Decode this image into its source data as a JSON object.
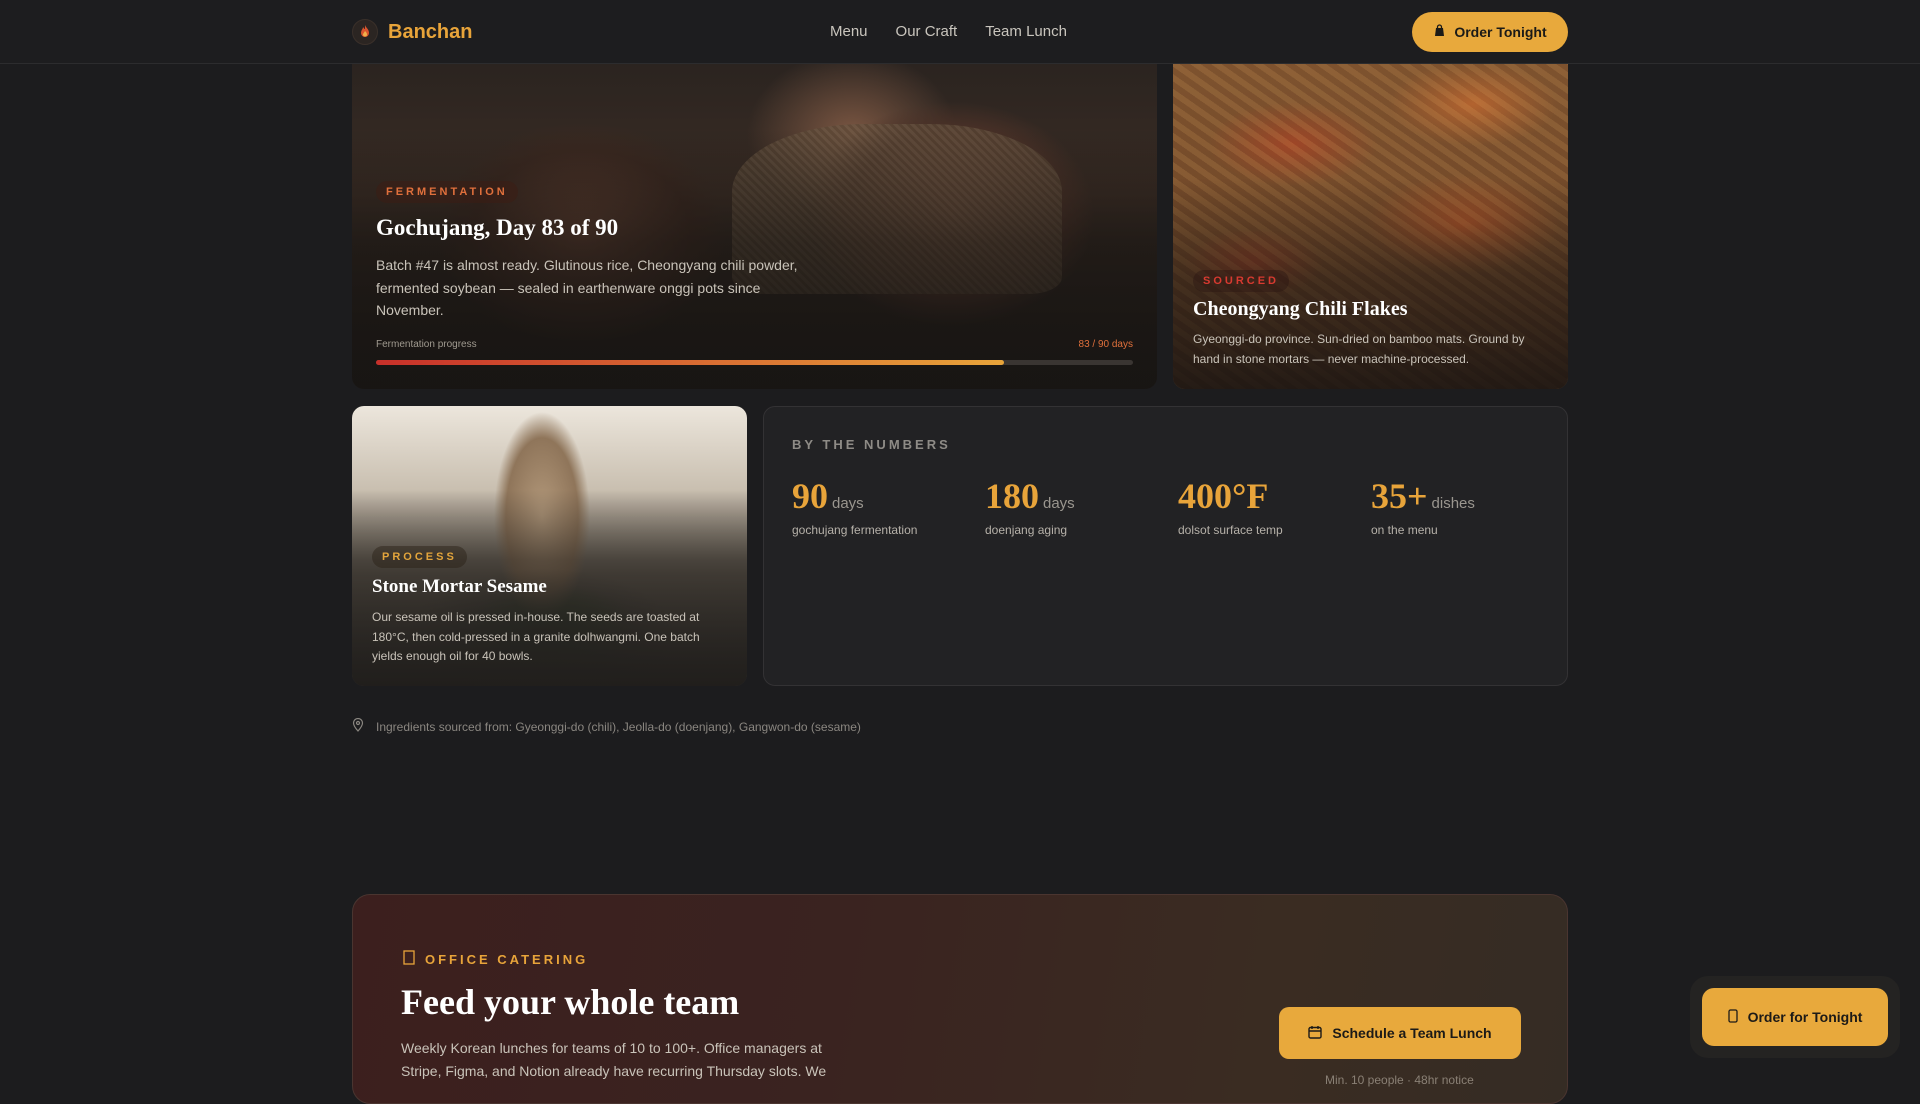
{
  "brand": {
    "name": "Banchan"
  },
  "nav": {
    "links": [
      "Menu",
      "Our Craft",
      "Team Lunch"
    ],
    "cta": "Order Tonight"
  },
  "hero": {
    "tag": "FERMENTATION",
    "title": "Gochujang, Day 83 of 90",
    "description": "Batch #47 is almost ready. Glutinous rice, Cheongyang chili powder, fermented soybean — sealed in earthenware onggi pots since November.",
    "progress_label": "Fermentation progress",
    "progress_count": "83 / 90 days",
    "progress_value": 0.922
  },
  "chili": {
    "tag": "SOURCED",
    "title": "Cheongyang Chili Flakes",
    "description": "Gyeonggi-do province. Sun-dried on bamboo mats. Ground by hand in stone mortars — never machine-processed."
  },
  "sesame": {
    "tag": "PROCESS",
    "title": "Stone Mortar Sesame",
    "description": "Our sesame oil is pressed in-house. The seeds are toasted at 180°C, then cold-pressed in a granite dolhwangmi. One batch yields enough oil for 40 bowls."
  },
  "numbers": {
    "eyebrow": "BY THE NUMBERS",
    "stats": [
      {
        "value": "90",
        "unit": "days",
        "label": "gochujang fermentation"
      },
      {
        "value": "180",
        "unit": "days",
        "label": "doenjang aging"
      },
      {
        "value": "400°F",
        "unit": "",
        "label": "dolsot surface temp"
      },
      {
        "value": "35+",
        "unit": "dishes",
        "label": "on the menu"
      }
    ]
  },
  "sourcing": "Ingredients sourced from: Gyeonggi-do (chili), Jeolla-do (doenjang), Gangwon-do (sesame)",
  "catering": {
    "eyebrow": "OFFICE CATERING",
    "title": "Feed your whole team",
    "description": "Weekly Korean lunches for teams of 10 to 100+. Office managers at Stripe, Figma, and Notion already have recurring Thursday slots. We",
    "cta": "Schedule a Team Lunch",
    "note": "Min. 10 people · 48hr notice"
  },
  "floating_cta": "Order for Tonight",
  "colors": {
    "accent": "#e8a93c",
    "ferment": "#e0703c",
    "chili_red": "#d83a30",
    "background": "#1c1c1e"
  }
}
